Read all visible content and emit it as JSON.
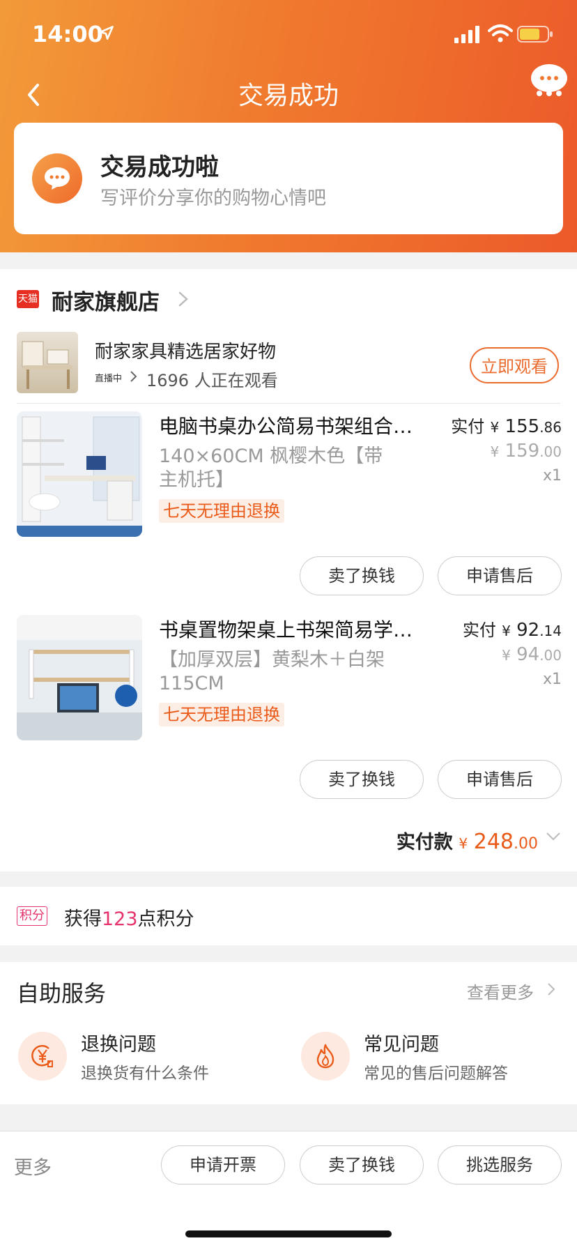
{
  "status_bar": {
    "time": "14:00"
  },
  "nav": {
    "title": "交易成功"
  },
  "success": {
    "title": "交易成功啦",
    "subtitle": "写评价分享你的购物心情吧"
  },
  "store": {
    "badge": "天猫",
    "name": "耐家旗舰店",
    "live": {
      "title": "耐家家具精选居家好物",
      "badge": "直播中",
      "viewers": "1696 人正在观看",
      "button": "立即观看"
    }
  },
  "items": [
    {
      "name": "电脑书桌办公简易书架组合…",
      "spec": "140×60CM 枫樱木色【带主机托】",
      "tag": "七天无理由退换",
      "paid_label": "实付",
      "paid_yen": "¥",
      "paid_int": "155",
      "paid_dec": ".86",
      "orig_yen": "¥",
      "orig_int": "159",
      "orig_dec": ".00",
      "qty": "x1",
      "btn_sell": "卖了换钱",
      "btn_aftersale": "申请售后"
    },
    {
      "name": "书桌置物架桌上书架简易学生…",
      "spec": "【加厚双层】黄梨木＋白架115CM",
      "tag": "七天无理由退换",
      "paid_label": "实付",
      "paid_yen": "¥",
      "paid_int": "92",
      "paid_dec": ".14",
      "orig_yen": "¥",
      "orig_int": "94",
      "orig_dec": ".00",
      "qty": "x1",
      "btn_sell": "卖了换钱",
      "btn_aftersale": "申请售后"
    }
  ],
  "total": {
    "label": "实付款",
    "yen": "¥",
    "int": "248",
    "dec": ".00"
  },
  "points": {
    "badge": "积分",
    "prefix": "获得",
    "value": "123",
    "suffix": "点积分"
  },
  "service": {
    "title": "自助服务",
    "more": "查看更多",
    "items": [
      {
        "title": "退换问题",
        "subtitle": "退换货有什么条件",
        "icon": "yen-return-icon"
      },
      {
        "title": "常见问题",
        "subtitle": "常见的售后问题解答",
        "icon": "flame-icon"
      }
    ]
  },
  "bottom": {
    "more": "更多",
    "buttons": [
      "申请开票",
      "卖了换钱",
      "挑选服务"
    ]
  },
  "colors": {
    "accent": "#ea5b1a",
    "brand_gradient_start": "#f29a3a",
    "brand_gradient_end": "#ec5a2a",
    "points": "#e6336b"
  }
}
